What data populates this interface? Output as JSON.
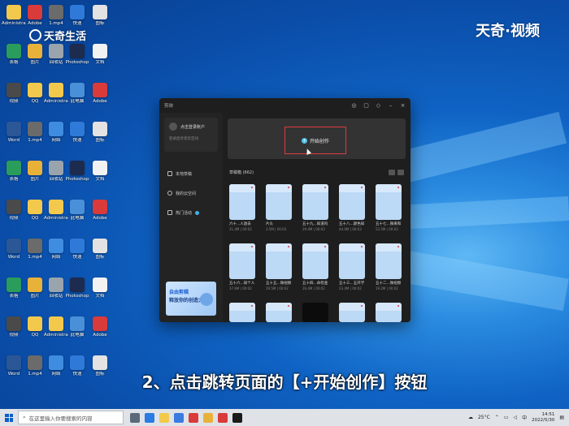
{
  "watermark": {
    "left_text": "天奇生活",
    "right_text": "天奇·视频"
  },
  "desktop_icons": [
    {
      "label": "Administrator",
      "color": "#f2c94c"
    },
    {
      "label": "此电脑",
      "color": "#4a90d9"
    },
    {
      "label": "Adobe",
      "color": "#d93a3a"
    },
    {
      "label": "Word",
      "color": "#2b5797"
    },
    {
      "label": "1.mp4",
      "color": "#6b6b6b"
    },
    {
      "label": "网络",
      "color": "#3f8de0"
    },
    {
      "label": "快速",
      "color": "#2f7ad9"
    },
    {
      "label": "图标",
      "color": "#e3e3e3"
    },
    {
      "label": "表格",
      "color": "#2a9d5c"
    },
    {
      "label": "图片",
      "color": "#e8b23a"
    },
    {
      "label": "回收站",
      "color": "#9aa4ad"
    },
    {
      "label": "Photoshop",
      "color": "#1d2b4f"
    },
    {
      "label": "文档",
      "color": "#f2f2f2"
    },
    {
      "label": "视频",
      "color": "#4a4a4a"
    },
    {
      "label": "QQ",
      "color": "#f2c94c"
    }
  ],
  "app": {
    "title": "剪映",
    "login": {
      "title": "点击登录账户",
      "subtitle": "登录后享受云空间"
    },
    "side_items": [
      "本地草稿",
      "我的云空间",
      "热门活动"
    ],
    "promo": {
      "line1": "自由剪辑",
      "line2": "释放你的创造力"
    },
    "start_button": "开始创作",
    "drafts_title": "草稿箱 (662)",
    "cards_row1": [
      {
        "name": "六十...人放去",
        "meta": "21.4M | 00:02"
      },
      {
        "name": "片头",
        "meta": "3.5M | 00:03"
      },
      {
        "name": "五十九...知道吗",
        "meta": "29.4M | 00:03"
      },
      {
        "name": "五十八...颜色知",
        "meta": "44.0M | 00:03"
      },
      {
        "name": "五十七...微来和",
        "meta": "53.5M | 00:03"
      }
    ],
    "cards_row2": [
      {
        "name": "五十六...知个人",
        "meta": "37.6M | 00:02"
      },
      {
        "name": "五十五...微视频",
        "meta": "29.5M | 00:02"
      },
      {
        "name": "五十四...命检查",
        "meta": "26.4M | 00:02"
      },
      {
        "name": "五十三...五开学",
        "meta": "23.4M | 00:02"
      },
      {
        "name": "五十二...微视频",
        "meta": "19.2M | 00:02"
      }
    ]
  },
  "caption": "2、点击跳转页面的【+开始创作】按钮",
  "taskbar": {
    "search_placeholder": "在这里输入你要搜索的内容",
    "weather": "25°C",
    "time": "14:51",
    "date": "2022/5/30"
  }
}
